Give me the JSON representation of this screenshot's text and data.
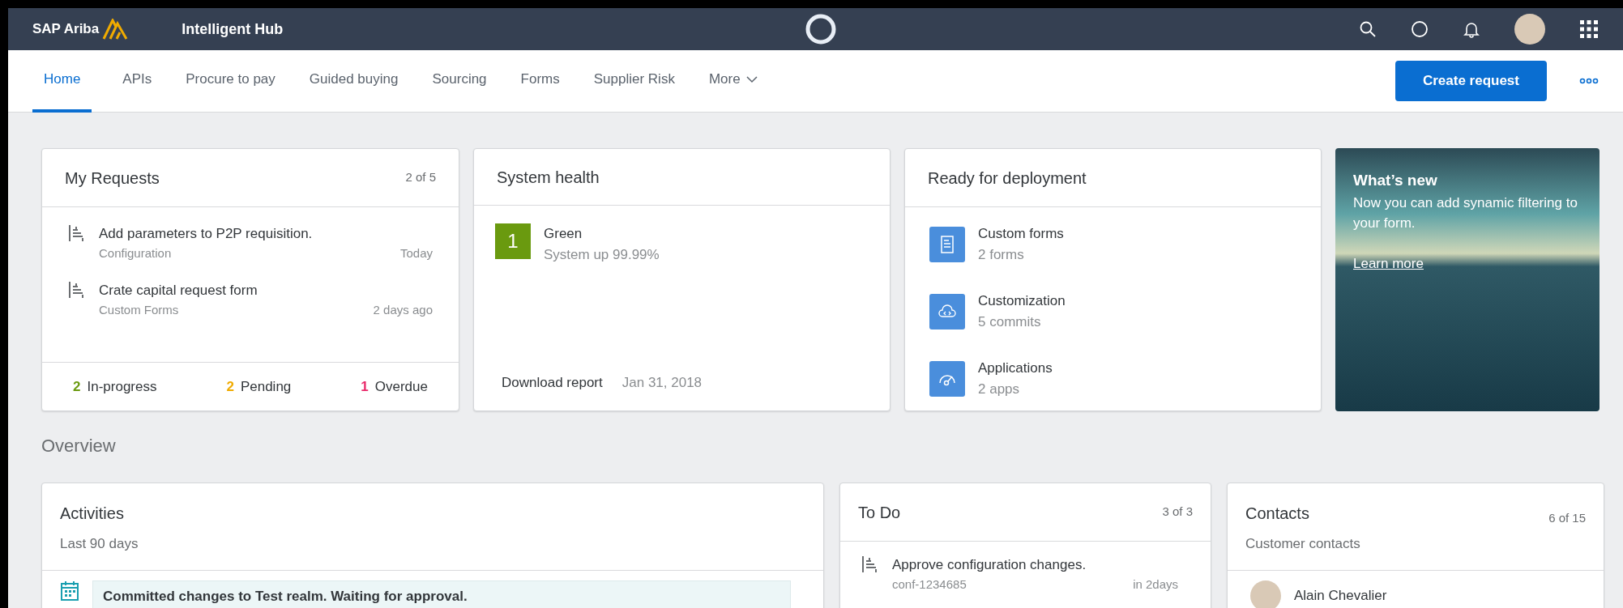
{
  "header": {
    "brand": "SAP Ariba",
    "app_title": "Intelligent Hub"
  },
  "nav": {
    "tabs": [
      {
        "label": "Home",
        "selected": true,
        "kind": "link"
      },
      {
        "label": "APIs",
        "selected": false,
        "kind": "link"
      },
      {
        "label": "Procure to pay",
        "selected": false,
        "kind": "link"
      },
      {
        "label": "Guided buying",
        "selected": false,
        "kind": "link"
      },
      {
        "label": "Sourcing",
        "selected": false,
        "kind": "link"
      },
      {
        "label": "Forms",
        "selected": false,
        "kind": "link"
      },
      {
        "label": "Supplier Risk",
        "selected": false,
        "kind": "link"
      },
      {
        "label": "More",
        "selected": false,
        "kind": "menu"
      }
    ],
    "primary_button": "Create request"
  },
  "my_requests": {
    "title": "My Requests",
    "count": "2 of 5",
    "items": [
      {
        "title": "Add parameters to P2P requisition.",
        "category": "Configuration",
        "time": "Today"
      },
      {
        "title": "Crate capital request form",
        "category": "Custom Forms",
        "time": "2 days ago"
      }
    ],
    "summary": [
      {
        "count": "2",
        "label": "In-progress",
        "color": "#6a9a0f"
      },
      {
        "count": "2",
        "label": "Pending",
        "color": "#f0ab00"
      },
      {
        "count": "1",
        "label": "Overdue",
        "color": "#e9296a"
      }
    ]
  },
  "system_health": {
    "title": "System health",
    "badge": "1",
    "status": "Green",
    "detail": "System up 99.99%",
    "report_link": "Download report",
    "date": "Jan 31, 2018"
  },
  "deployment": {
    "title": "Ready for deployment",
    "items": [
      {
        "kind": "form",
        "title": "Custom forms",
        "detail": "2 forms"
      },
      {
        "kind": "code",
        "title": "Customization",
        "detail": "5 commits"
      },
      {
        "kind": "gauge",
        "title": "Applications",
        "detail": "2 apps"
      }
    ]
  },
  "whats_new": {
    "title": "What’s new",
    "text": "Now you can add synamic filtering to your form.",
    "link": "Learn more"
  },
  "overview": {
    "heading": "Overview",
    "activities": {
      "title": "Activities",
      "subtitle": "Last 90 days",
      "items": [
        {
          "text": "Committed changes to Test realm. Waiting for approval."
        }
      ]
    },
    "todo": {
      "title": "To Do",
      "count": "3 of  3",
      "items": [
        {
          "title": "Approve configuration changes.",
          "ref": "conf-1234685",
          "due": "in 2days"
        }
      ]
    },
    "contacts": {
      "title": "Contacts",
      "count": "6 of 15",
      "subtitle": "Customer contacts",
      "items": [
        {
          "name": "Alain Chevalier"
        }
      ]
    }
  }
}
